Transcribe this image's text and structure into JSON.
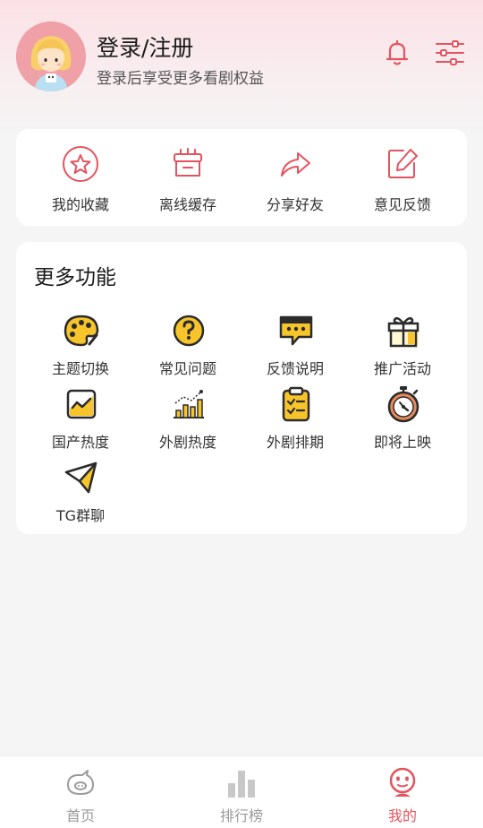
{
  "header": {
    "title": "登录/注册",
    "subtitle": "登录后享受更多看剧权益"
  },
  "quick_actions": [
    {
      "label": "我的收藏",
      "icon": "star-icon"
    },
    {
      "label": "离线缓存",
      "icon": "download-box-icon"
    },
    {
      "label": "分享好友",
      "icon": "share-icon"
    },
    {
      "label": "意见反馈",
      "icon": "edit-icon"
    }
  ],
  "more": {
    "title": "更多功能",
    "items": [
      {
        "label": "主题切换",
        "icon": "palette-icon"
      },
      {
        "label": "常见问题",
        "icon": "question-icon"
      },
      {
        "label": "反馈说明",
        "icon": "chat-icon"
      },
      {
        "label": "推广活动",
        "icon": "gift-icon"
      },
      {
        "label": "国产热度",
        "icon": "trend-icon"
      },
      {
        "label": "外剧热度",
        "icon": "bar-chart-icon"
      },
      {
        "label": "外剧排期",
        "icon": "clipboard-icon"
      },
      {
        "label": "即将上映",
        "icon": "stopwatch-icon"
      },
      {
        "label": "TG群聊",
        "icon": "telegram-icon"
      }
    ]
  },
  "tabbar": [
    {
      "label": "首页",
      "icon": "home-pig-icon",
      "active": false
    },
    {
      "label": "排行榜",
      "icon": "ranking-icon",
      "active": false
    },
    {
      "label": "我的",
      "icon": "mine-icon",
      "active": true
    }
  ],
  "colors": {
    "accent": "#e5535f",
    "icon_yellow": "#f7c52b",
    "icon_dark": "#2b2b2b"
  }
}
